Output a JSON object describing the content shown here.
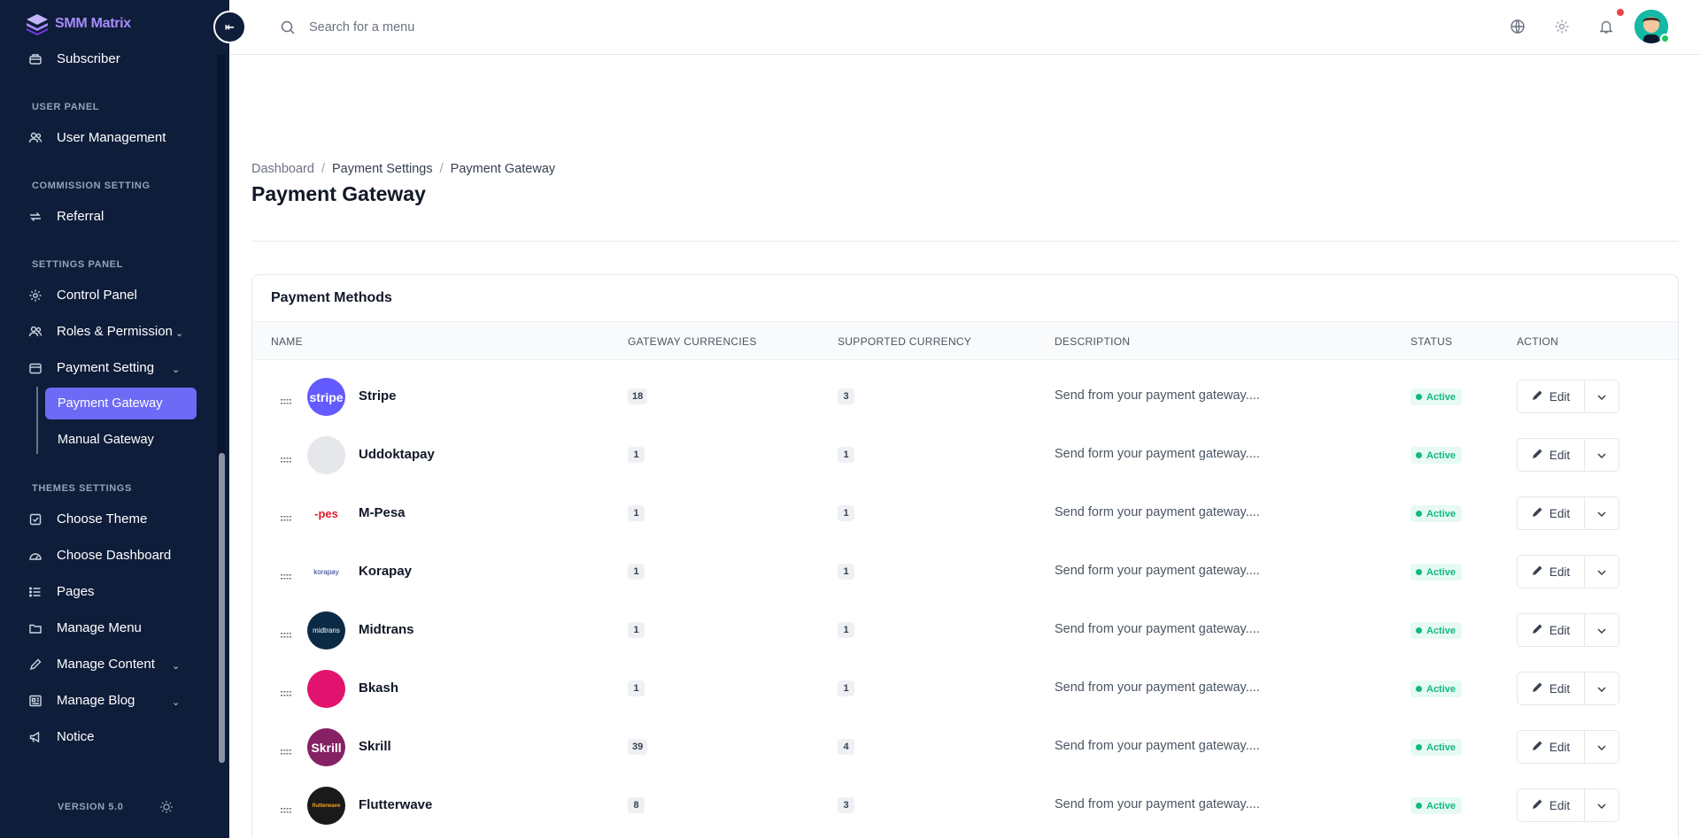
{
  "app": {
    "name": "SMM Matrix",
    "version": "VERSION 5.0"
  },
  "sidebar": {
    "items_top": [
      {
        "label": "Subscriber",
        "icon": "subscriber-icon"
      }
    ],
    "sections": [
      {
        "title": "USER PANEL",
        "items": [
          {
            "label": "User Management",
            "icon": "users-icon",
            "has_children": true
          }
        ]
      },
      {
        "title": "COMMISSION SETTING",
        "items": [
          {
            "label": "Referral",
            "icon": "refresh-icon",
            "has_children": false
          }
        ]
      },
      {
        "title": "SETTINGS PANEL",
        "items": [
          {
            "label": "Control Panel",
            "icon": "gear-icon",
            "has_children": false
          },
          {
            "label": "Roles & Permission",
            "icon": "users-icon",
            "has_children": true
          },
          {
            "label": "Payment Setting",
            "icon": "wallet-icon",
            "has_children": true,
            "expanded": true,
            "children": [
              {
                "label": "Payment Gateway",
                "active": true
              },
              {
                "label": "Manual Gateway",
                "active": false
              }
            ]
          }
        ]
      },
      {
        "title": "THEMES SETTINGS",
        "items": [
          {
            "label": "Choose Theme",
            "icon": "checkbox-icon",
            "has_children": false
          },
          {
            "label": "Choose Dashboard",
            "icon": "gauge-icon",
            "has_children": false
          },
          {
            "label": "Pages",
            "icon": "list-icon",
            "has_children": false
          },
          {
            "label": "Manage Menu",
            "icon": "folder-icon",
            "has_children": false
          },
          {
            "label": "Manage Content",
            "icon": "pencil-icon",
            "has_children": true
          },
          {
            "label": "Manage Blog",
            "icon": "newspaper-icon",
            "has_children": true
          },
          {
            "label": "Notice",
            "icon": "megaphone-icon",
            "has_children": false
          }
        ]
      }
    ]
  },
  "topbar": {
    "search_placeholder": "Search for a menu"
  },
  "breadcrumb": {
    "items": [
      "Dashboard",
      "Payment Settings",
      "Payment Gateway"
    ],
    "separator": "/"
  },
  "page": {
    "title": "Payment Gateway"
  },
  "card": {
    "title": "Payment Methods",
    "columns": [
      "NAME",
      "GATEWAY CURRENCIES",
      "SUPPORTED CURRENCY",
      "DESCRIPTION",
      "STATUS",
      "ACTION"
    ],
    "edit_label": "Edit",
    "rows": [
      {
        "name": "Stripe",
        "logo_text": "stripe",
        "logo_color": "#635bff",
        "gateway_currencies": "18",
        "supported_currency": "3",
        "description": "Send from your payment gateway....",
        "status": "Active"
      },
      {
        "name": "Uddoktapay",
        "logo_text": "",
        "logo_color": "#e5e7eb",
        "gateway_currencies": "1",
        "supported_currency": "1",
        "description": "Send form your payment gateway....",
        "status": "Active"
      },
      {
        "name": "M-Pesa",
        "logo_text": "-pes",
        "logo_color": "#ffffff",
        "gateway_currencies": "1",
        "supported_currency": "1",
        "description": "Send form your payment gateway....",
        "status": "Active"
      },
      {
        "name": "Korapay",
        "logo_text": "korapay",
        "logo_color": "#ffffff",
        "gateway_currencies": "1",
        "supported_currency": "1",
        "description": "Send form your payment gateway....",
        "status": "Active"
      },
      {
        "name": "Midtrans",
        "logo_text": "midtrans",
        "logo_color": "#0b2a45",
        "gateway_currencies": "1",
        "supported_currency": "1",
        "description": "Send from your payment gateway....",
        "status": "Active"
      },
      {
        "name": "Bkash",
        "logo_text": "",
        "logo_color": "#e2136e",
        "gateway_currencies": "1",
        "supported_currency": "1",
        "description": "Send from your payment gateway....",
        "status": "Active"
      },
      {
        "name": "Skrill",
        "logo_text": "Skrill",
        "logo_color": "#862165",
        "gateway_currencies": "39",
        "supported_currency": "4",
        "description": "Send from your payment gateway....",
        "status": "Active"
      },
      {
        "name": "Flutterwave",
        "logo_text": "flutterwave",
        "logo_color": "#1a1a1a",
        "gateway_currencies": "8",
        "supported_currency": "3",
        "description": "Send from your payment gateway....",
        "status": "Active"
      }
    ]
  },
  "colors": {
    "sidebar_bg": "#0e1d3a",
    "accent": "#6d6af5",
    "status_active": "#10b981"
  }
}
